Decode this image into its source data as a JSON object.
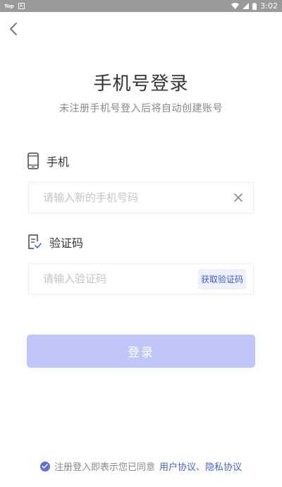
{
  "status_bar": {
    "app_tag": "Top",
    "small_icon_letter": "A",
    "time": "3:02"
  },
  "header": {
    "back_icon": "chevron-left-icon"
  },
  "title": "手机号登录",
  "subtitle": "未注册手机号登入后将自动创建账号",
  "phone": {
    "label": "手机",
    "icon": "phone-icon",
    "placeholder": "请输入新的手机号码",
    "value": "",
    "clear_icon": "close-icon"
  },
  "code": {
    "label": "验证码",
    "icon": "document-check-icon",
    "placeholder": "请输入验证码",
    "value": "",
    "get_code_label": "获取验证码"
  },
  "login_button_label": "登录",
  "agreement": {
    "text": "注册登入即表示您已同意",
    "links": "用户协议、隐私协议"
  },
  "colors": {
    "accent": "#4a62d8",
    "login_disabled": "#c0c6f7",
    "status_bar": "#9a9a9a"
  }
}
